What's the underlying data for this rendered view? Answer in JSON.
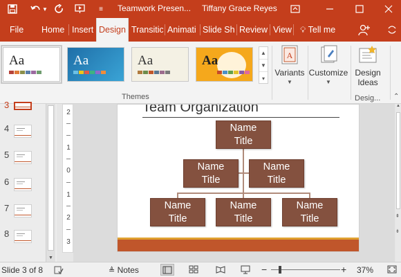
{
  "titlebar": {
    "document_title": "Teamwork Presen...",
    "user_name": "Tiffany Grace Reyes",
    "icons": [
      "save-icon",
      "undo-icon",
      "redo-icon",
      "start-from-beginning-icon",
      "customize-qat-icon",
      "ribbon-display-icon",
      "minimize-icon",
      "maximize-icon",
      "close-icon"
    ]
  },
  "tabs": [
    {
      "label": "File"
    },
    {
      "label": "Home"
    },
    {
      "label": "Insert"
    },
    {
      "label": "Design",
      "active": true
    },
    {
      "label": "Transitic"
    },
    {
      "label": "Animati"
    },
    {
      "label": "Slide Sh"
    },
    {
      "label": "Review"
    },
    {
      "label": "View"
    }
  ],
  "tell_me": "Tell me",
  "ribbon": {
    "themes": [
      {
        "sample": "Aa",
        "bg": "#ffffff",
        "fg": "#222222",
        "colors": [
          "#b6433a",
          "#e07b39",
          "#8b8f4a",
          "#5a7fa8",
          "#9c6aa0",
          "#6f9d6f"
        ]
      },
      {
        "sample": "Aa",
        "bg": "#2a8bbf",
        "fg": "#ffffff",
        "colors": [
          "#6cc0e5",
          "#f0c419",
          "#e05a47",
          "#3fb27f",
          "#8f6ac9",
          "#f08c3a"
        ]
      },
      {
        "sample": "Aa",
        "bg": "#f4f1e4",
        "fg": "#333333",
        "colors": [
          "#b07b3e",
          "#6e8c4a",
          "#c0572b",
          "#5a7791",
          "#9c6c8d",
          "#7a7a7a"
        ]
      },
      {
        "sample": "Aa",
        "bg": "#f5a81c",
        "fg": "#222222",
        "colors": [
          "#c44b2b",
          "#4a90c8",
          "#62a04b",
          "#e3c22b",
          "#8a5ca8",
          "#e06a9f"
        ]
      }
    ],
    "themes_label": "Themes",
    "variants_label": "Variants",
    "customize_label": "Customize",
    "design_ideas_label_1": "Design",
    "design_ideas_label_2": "Ideas",
    "designer_group_label": "Desig..."
  },
  "slide_panel": {
    "numbers": [
      "3",
      "4",
      "5",
      "6",
      "7",
      "8"
    ]
  },
  "ruler": {
    "ticks": [
      "2",
      "1",
      "0",
      "1",
      "2",
      "3"
    ]
  },
  "slide": {
    "title": "Team Organization",
    "org": {
      "top": {
        "name": "Name",
        "title": "Title"
      },
      "middle": [
        {
          "name": "Name",
          "title": "Title"
        },
        {
          "name": "Name",
          "title": "Title"
        }
      ],
      "bottom": [
        {
          "name": "Name",
          "title": "Title"
        },
        {
          "name": "Name",
          "title": "Title"
        },
        {
          "name": "Name",
          "title": "Title"
        }
      ]
    }
  },
  "status": {
    "slide_info": "Slide 3 of 8",
    "notes_label": "Notes",
    "zoom": "37%",
    "zoom_level": 0.37
  },
  "colors": {
    "accent": "#c43e1c",
    "org_box": "#84513f",
    "footer_band": "#c0562b"
  }
}
